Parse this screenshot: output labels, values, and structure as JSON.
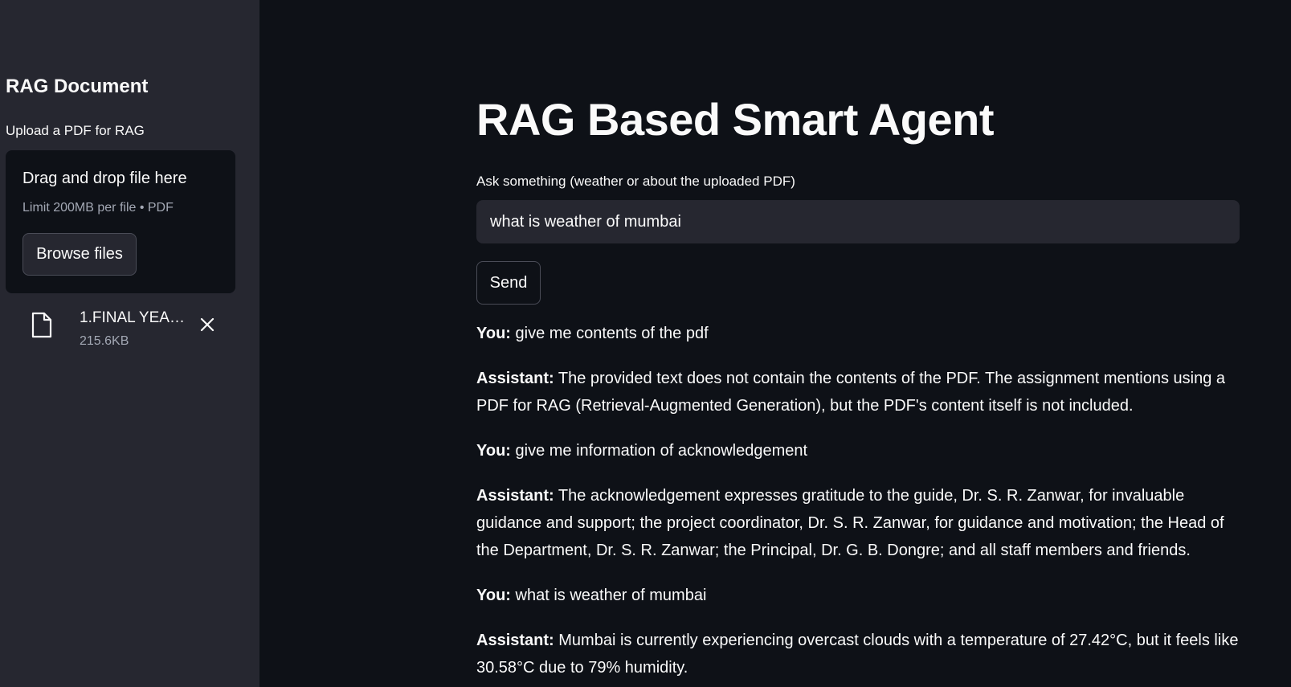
{
  "sidebar": {
    "title": "RAG Document",
    "upload_label": "Upload a PDF for RAG",
    "dropzone": {
      "title": "Drag and drop file here",
      "limit": "Limit 200MB per file • PDF",
      "browse_label": "Browse files"
    },
    "file": {
      "name": "1.FINAL YEAR …",
      "size": "215.6KB"
    }
  },
  "main": {
    "title": "RAG Based Smart Agent",
    "input_label": "Ask something (weather or about the uploaded PDF)",
    "input_value": "what is weather of mumbai",
    "send_label": "Send",
    "messages": [
      {
        "speaker": "You:",
        "text": "give me contents of the pdf"
      },
      {
        "speaker": "Assistant:",
        "text": "The provided text does not contain the contents of the PDF. The assignment mentions using a PDF for RAG (Retrieval-Augmented Generation), but the PDF's content itself is not included."
      },
      {
        "speaker": "You:",
        "text": "give me information of acknowledgement"
      },
      {
        "speaker": "Assistant:",
        "text": "The acknowledgement expresses gratitude to the guide, Dr. S. R. Zanwar, for invaluable guidance and support; the project coordinator, Dr. S. R. Zanwar, for guidance and motivation; the Head of the Department, Dr. S. R. Zanwar; the Principal, Dr. G. B. Dongre; and all staff members and friends."
      },
      {
        "speaker": "You:",
        "text": "what is weather of mumbai"
      },
      {
        "speaker": "Assistant:",
        "text": "Mumbai is currently experiencing overcast clouds with a temperature of 27.42°C, but it feels like 30.58°C due to 79% humidity."
      }
    ]
  },
  "icons": {
    "file": "file-icon",
    "remove": "close-icon"
  },
  "colors": {
    "background": "#0e1117",
    "sidebar": "#262730",
    "text": "#fafafa",
    "muted": "#a3a8b4",
    "border": "#4a4c57"
  }
}
